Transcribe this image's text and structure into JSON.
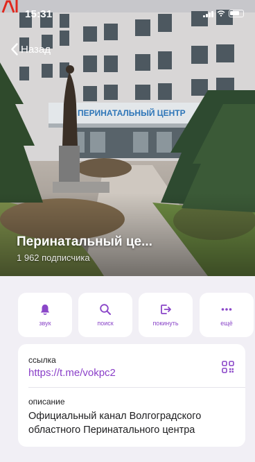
{
  "status_bar": {
    "time": "15:31"
  },
  "nav": {
    "back_label": "Назад"
  },
  "hero": {
    "sign_text": "ПЕРИНАТАЛЬНЫЙ ЦЕНТР",
    "channel_name": "Перинатальный це...",
    "subscribers": "1 962 подписчика"
  },
  "actions": [
    {
      "label": "звук",
      "icon": "bell-icon"
    },
    {
      "label": "поиск",
      "icon": "search-icon"
    },
    {
      "label": "покинуть",
      "icon": "leave-icon"
    },
    {
      "label": "ещё",
      "icon": "more-icon"
    }
  ],
  "info": {
    "link_caption": "ссылка",
    "link_value": "https://t.me/vokpc2",
    "description_caption": "описание",
    "description_value": "Официальный канал Волгоградского областного Перинатального центра"
  },
  "colors": {
    "accent": "#8a3fc8",
    "background": "#f1eff5",
    "card": "#ffffff"
  }
}
